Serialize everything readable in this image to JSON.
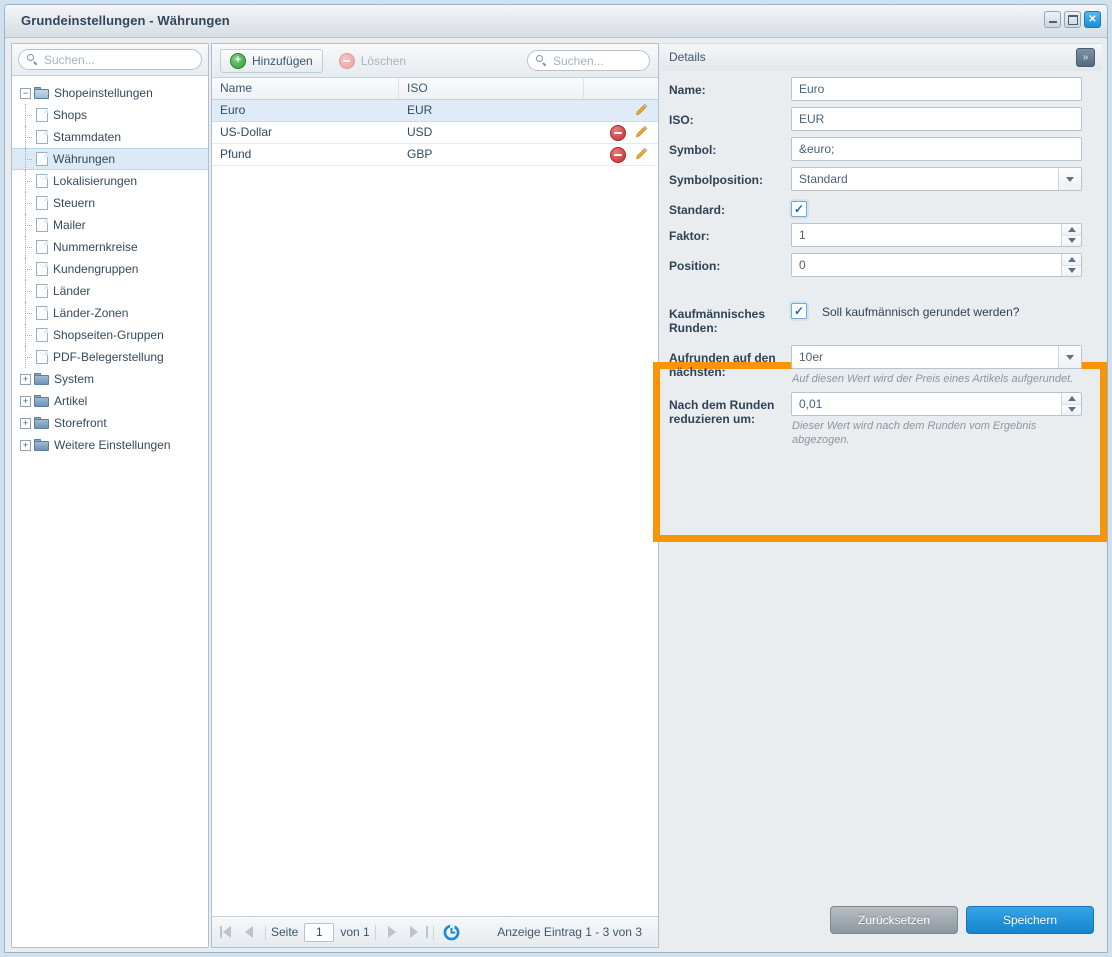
{
  "window": {
    "title": "Grundeinstellungen - Währungen",
    "controls": {
      "minimize": "–",
      "maximize": "□",
      "close": "✕"
    }
  },
  "sidebar": {
    "search_placeholder": "Suchen...",
    "items": [
      {
        "label": "Shopeinstellungen",
        "type": "folder-open",
        "depth": 0,
        "expander": "−",
        "selected": false
      },
      {
        "label": "Shops",
        "type": "doc",
        "depth": 1,
        "selected": false
      },
      {
        "label": "Stammdaten",
        "type": "doc",
        "depth": 1,
        "selected": false
      },
      {
        "label": "Währungen",
        "type": "doc",
        "depth": 1,
        "selected": true
      },
      {
        "label": "Lokalisierungen",
        "type": "doc",
        "depth": 1,
        "selected": false
      },
      {
        "label": "Steuern",
        "type": "doc",
        "depth": 1,
        "selected": false
      },
      {
        "label": "Mailer",
        "type": "doc",
        "depth": 1,
        "selected": false
      },
      {
        "label": "Nummernkreise",
        "type": "doc",
        "depth": 1,
        "selected": false
      },
      {
        "label": "Kundengruppen",
        "type": "doc",
        "depth": 1,
        "selected": false
      },
      {
        "label": "Länder",
        "type": "doc",
        "depth": 1,
        "selected": false
      },
      {
        "label": "Länder-Zonen",
        "type": "doc",
        "depth": 1,
        "selected": false
      },
      {
        "label": "Shopseiten-Gruppen",
        "type": "doc",
        "depth": 1,
        "selected": false
      },
      {
        "label": "PDF-Belegerstellung",
        "type": "doc",
        "depth": 1,
        "selected": false
      },
      {
        "label": "System",
        "type": "folder",
        "depth": 0,
        "expander": "+",
        "selected": false
      },
      {
        "label": "Artikel",
        "type": "folder",
        "depth": 0,
        "expander": "+",
        "selected": false
      },
      {
        "label": "Storefront",
        "type": "folder",
        "depth": 0,
        "expander": "+",
        "selected": false
      },
      {
        "label": "Weitere Einstellungen",
        "type": "folder",
        "depth": 0,
        "expander": "+",
        "selected": false
      }
    ]
  },
  "grid": {
    "toolbar": {
      "add_label": "Hinzufügen",
      "delete_label": "Löschen",
      "search_placeholder": "Suchen..."
    },
    "columns": [
      "Name",
      "ISO",
      ""
    ],
    "rows": [
      {
        "name": "Euro",
        "iso": "EUR",
        "selected": true,
        "deletable": false
      },
      {
        "name": "US-Dollar",
        "iso": "USD",
        "selected": false,
        "deletable": true
      },
      {
        "name": "Pfund",
        "iso": "GBP",
        "selected": false,
        "deletable": true
      }
    ],
    "footer": {
      "page_label": "Seite",
      "page_value": "1",
      "of_label": "von 1",
      "count_label": "Anzeige Eintrag 1 - 3 von 3"
    }
  },
  "details": {
    "title": "Details",
    "collapse_icon": "»",
    "fields": {
      "name_label": "Name:",
      "name_value": "Euro",
      "iso_label": "ISO:",
      "iso_value": "EUR",
      "symbol_label": "Symbol:",
      "symbol_value": "&euro;",
      "symbolposition_label": "Symbolposition:",
      "symbolposition_value": "Standard",
      "standard_label": "Standard:",
      "standard_checked": "✓",
      "faktor_label": "Faktor:",
      "faktor_value": "1",
      "position_label": "Position:",
      "position_value": "0",
      "rounding_label": "Kaufmännisches Runden:",
      "rounding_checked": "✓",
      "rounding_text": "Soll kaufmännisch gerundet werden?",
      "roundup_label": "Aufrunden auf den nächsten:",
      "roundup_value": "10er",
      "roundup_hint": "Auf diesen Wert wird der Preis eines Artikels aufgerundet.",
      "reduce_label": "Nach dem Runden reduzieren um:",
      "reduce_value": "0,01",
      "reduce_hint": "Dieser Wert wird nach dem Runden vom Ergebnis abgezogen."
    },
    "buttons": {
      "reset": "Zurücksetzen",
      "save": "Speichern"
    }
  },
  "colors": {
    "highlight": "#f89406",
    "accent": "#1784cd",
    "window_bg": "#cfe0ee",
    "panel_bg": "#e9edf0"
  }
}
